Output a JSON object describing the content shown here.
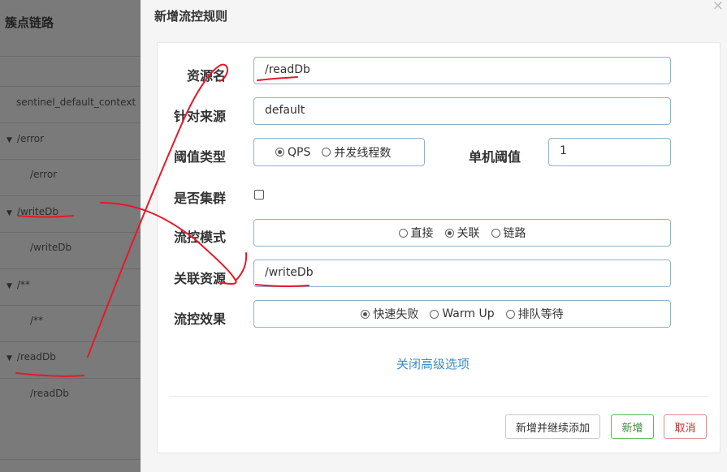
{
  "tree": {
    "title": "簇点链路",
    "items": [
      {
        "label": "sentinel_default_context",
        "expandable": false
      },
      {
        "label": "/error",
        "expandable": true
      },
      {
        "label": "/error",
        "expandable": false
      },
      {
        "label": "/writeDb",
        "expandable": true
      },
      {
        "label": "/writeDb",
        "expandable": false
      },
      {
        "label": "/**",
        "expandable": true
      },
      {
        "label": "/**",
        "expandable": false
      },
      {
        "label": "/readDb",
        "expandable": true
      },
      {
        "label": "/readDb",
        "expandable": false
      }
    ]
  },
  "modal": {
    "title": "新增流控规则",
    "close_icon": "×",
    "form": {
      "resource_name": {
        "label": "资源名",
        "value": "/readDb"
      },
      "limit_app": {
        "label": "针对来源",
        "value": "default"
      },
      "threshold_type": {
        "label": "阈值类型",
        "options": [
          "QPS",
          "并发线程数"
        ],
        "selected": "QPS"
      },
      "threshold": {
        "label": "单机阈值",
        "value": "1"
      },
      "cluster": {
        "label": "是否集群",
        "checked": false
      },
      "strategy": {
        "label": "流控模式",
        "options": [
          "直接",
          "关联",
          "链路"
        ],
        "selected": "关联"
      },
      "ref_resource": {
        "label": "关联资源",
        "value": "/writeDb"
      },
      "control_behavior": {
        "label": "流控效果",
        "options": [
          "快速失败",
          "Warm Up",
          "排队等待"
        ],
        "selected": "快速失败"
      }
    },
    "advanced_link": "关闭高级选项",
    "buttons": {
      "add_continue": "新增并继续添加",
      "add": "新增",
      "cancel": "取消"
    }
  },
  "annotation_color": "#e8172a"
}
